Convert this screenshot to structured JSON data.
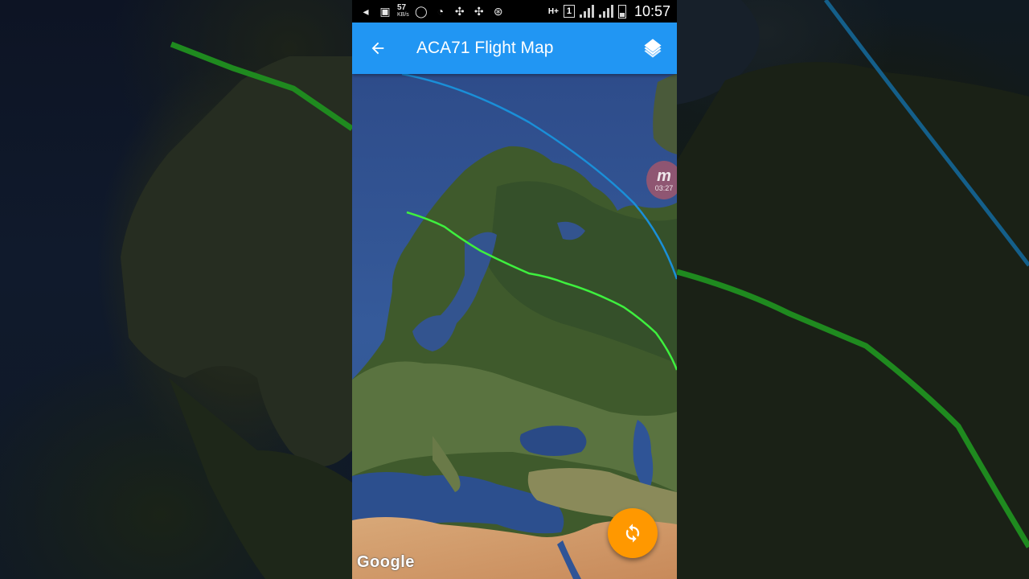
{
  "status_bar": {
    "net_speed": "57",
    "net_speed_unit": "KB/s",
    "network_type": "H+",
    "sim_slot": "1",
    "time": "10:57",
    "icons": [
      "back-icon",
      "gallery-icon",
      "whatsapp-icon",
      "messenger-icon",
      "pinwheel-icon",
      "pinwheel-icon",
      "football-icon",
      "network-icon",
      "signal-icon",
      "battery-icon"
    ]
  },
  "app_bar": {
    "title": "ACA71 Flight Map",
    "back_icon": "arrow-left-icon",
    "layers_icon": "layers-icon",
    "color": "#2196f3"
  },
  "map": {
    "attribution": "Google",
    "type": "satellite",
    "flight_path_color": "#3ef03e",
    "great_circle_color": "#1a8fd8"
  },
  "fab": {
    "icon": "refresh-icon",
    "color": "#ff9800"
  },
  "watermark": {
    "logo": "m",
    "time": "03:27"
  }
}
